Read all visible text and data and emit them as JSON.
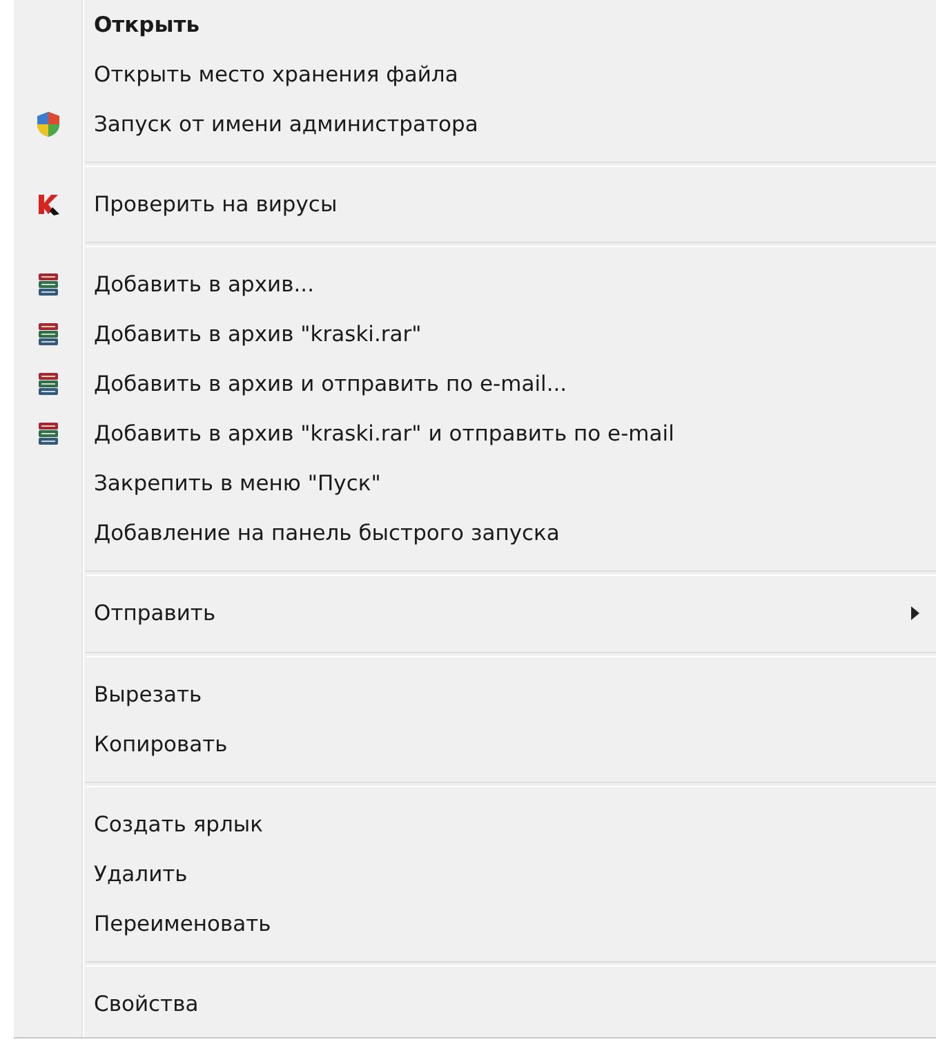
{
  "menu": {
    "groups": [
      {
        "items": [
          {
            "kind": "plain",
            "label": "Открыть",
            "default": true,
            "submenu": false
          },
          {
            "kind": "plain",
            "label": "Открыть место хранения файла",
            "default": false,
            "submenu": false
          },
          {
            "kind": "shield",
            "label": "Запуск от имени администратора",
            "default": false,
            "submenu": false
          }
        ]
      },
      {
        "items": [
          {
            "kind": "antivirus",
            "label": "Проверить на вирусы",
            "default": false,
            "submenu": false
          }
        ]
      },
      {
        "items": [
          {
            "kind": "archive",
            "label": "Добавить в архив...",
            "default": false,
            "submenu": false
          },
          {
            "kind": "archive",
            "label": "Добавить в архив \"kraski.rar\"",
            "default": false,
            "submenu": false
          },
          {
            "kind": "archive",
            "label": "Добавить в архив и отправить по e-mail...",
            "default": false,
            "submenu": false
          },
          {
            "kind": "archive",
            "label": "Добавить в архив \"kraski.rar\" и отправить по e-mail",
            "default": false,
            "submenu": false
          },
          {
            "kind": "plain",
            "label": "Закрепить в меню \"Пуск\"",
            "default": false,
            "submenu": false
          },
          {
            "kind": "plain",
            "label": "Добавление на панель быстрого запуска",
            "default": false,
            "submenu": false
          }
        ]
      },
      {
        "items": [
          {
            "kind": "plain",
            "label": "Отправить",
            "default": false,
            "submenu": true
          }
        ]
      },
      {
        "items": [
          {
            "kind": "plain",
            "label": "Вырезать",
            "default": false,
            "submenu": false
          },
          {
            "kind": "plain",
            "label": "Копировать",
            "default": false,
            "submenu": false
          }
        ]
      },
      {
        "items": [
          {
            "kind": "plain",
            "label": "Создать ярлык",
            "default": false,
            "submenu": false
          },
          {
            "kind": "plain",
            "label": "Удалить",
            "default": false,
            "submenu": false
          },
          {
            "kind": "plain",
            "label": "Переименовать",
            "default": false,
            "submenu": false
          }
        ]
      },
      {
        "items": [
          {
            "kind": "plain",
            "label": "Свойства",
            "default": false,
            "submenu": false
          }
        ]
      }
    ]
  }
}
